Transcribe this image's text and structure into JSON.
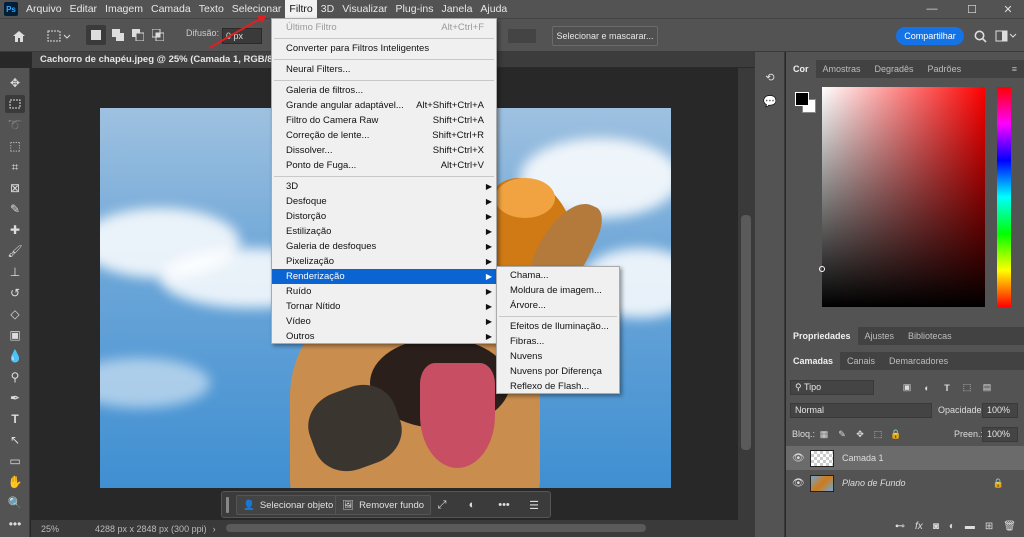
{
  "app": {
    "logo": "Ps"
  },
  "menubar": {
    "items": [
      "Arquivo",
      "Editar",
      "Imagem",
      "Camada",
      "Texto",
      "Selecionar",
      "Filtro",
      "3D",
      "Visualizar",
      "Plug-ins",
      "Janela",
      "Ajuda"
    ],
    "active": "Filtro"
  },
  "window_controls": {
    "minimize": "—",
    "maximize": "☐",
    "close": "✕"
  },
  "options_bar": {
    "difusao_label": "Difusão:",
    "difusao_value": "0 px",
    "select_mask_button": "Selecionar e mascarar...",
    "share_button": "Compartilhar"
  },
  "document": {
    "tab_title": "Cachorro de chapéu.jpeg @ 25% (Camada 1, RGB/8#) *"
  },
  "status": {
    "zoom": "25%",
    "dimensions": "4288 px x 2848 px (300 ppi)"
  },
  "context_bar": {
    "select_object": "Selecionar objeto",
    "remove_background": "Remover fundo",
    "more": "•••"
  },
  "filter_menu": {
    "items": [
      {
        "label": "Último Filtro",
        "shortcut": "Alt+Ctrl+F",
        "disabled": true
      },
      {
        "label": "Converter para Filtros Inteligentes"
      },
      {
        "label": "Neural Filters..."
      },
      {
        "label": "Galeria de filtros..."
      },
      {
        "label": "Grande angular adaptável...",
        "shortcut": "Alt+Shift+Ctrl+A"
      },
      {
        "label": "Filtro do Camera Raw",
        "shortcut": "Shift+Ctrl+A"
      },
      {
        "label": "Correção de lente...",
        "shortcut": "Shift+Ctrl+R"
      },
      {
        "label": "Dissolver...",
        "shortcut": "Shift+Ctrl+X"
      },
      {
        "label": "Ponto de Fuga...",
        "shortcut": "Alt+Ctrl+V"
      },
      {
        "label": "3D",
        "submenu": true
      },
      {
        "label": "Desfoque",
        "submenu": true
      },
      {
        "label": "Distorção",
        "submenu": true
      },
      {
        "label": "Estilização",
        "submenu": true
      },
      {
        "label": "Galeria de desfoques",
        "submenu": true
      },
      {
        "label": "Pixelização",
        "submenu": true
      },
      {
        "label": "Renderização",
        "submenu": true,
        "highlighted": true
      },
      {
        "label": "Ruído",
        "submenu": true
      },
      {
        "label": "Tornar Nítido",
        "submenu": true
      },
      {
        "label": "Vídeo",
        "submenu": true
      },
      {
        "label": "Outros",
        "submenu": true
      }
    ]
  },
  "render_submenu": {
    "items": [
      "Chama...",
      "Moldura de imagem...",
      "Árvore...",
      "Efeitos de Iluminação...",
      "Fibras...",
      "Nuvens",
      "Nuvens por Diferença",
      "Reflexo de Flash..."
    ]
  },
  "color_panel": {
    "tabs": [
      "Cor",
      "Amostras",
      "Degradês",
      "Padrões"
    ],
    "active": "Cor",
    "foreground": "#000000",
    "background": "#ffffff",
    "hue_color": "#ff0000"
  },
  "properties_panel": {
    "tabs": [
      "Propriedades",
      "Ajustes",
      "Bibliotecas"
    ],
    "active": "Propriedades"
  },
  "layers_panel": {
    "tabs": [
      "Camadas",
      "Canais",
      "Demarcadores"
    ],
    "active": "Camadas",
    "filter_kind": "Tipo",
    "blend_mode": "Normal",
    "opacity_label": "Opacidade:",
    "opacity_value": "100%",
    "lock_label": "Bloq.:",
    "fill_label": "Preen.:",
    "fill_value": "100%",
    "layers": [
      {
        "name": "Camada 1",
        "selected": true,
        "italic": false
      },
      {
        "name": "Plano de Fundo",
        "selected": false,
        "italic": true,
        "locked": true
      }
    ]
  },
  "colors": {
    "accent": "#0a64d2",
    "share": "#1473e6",
    "arrow": "#e02020"
  }
}
